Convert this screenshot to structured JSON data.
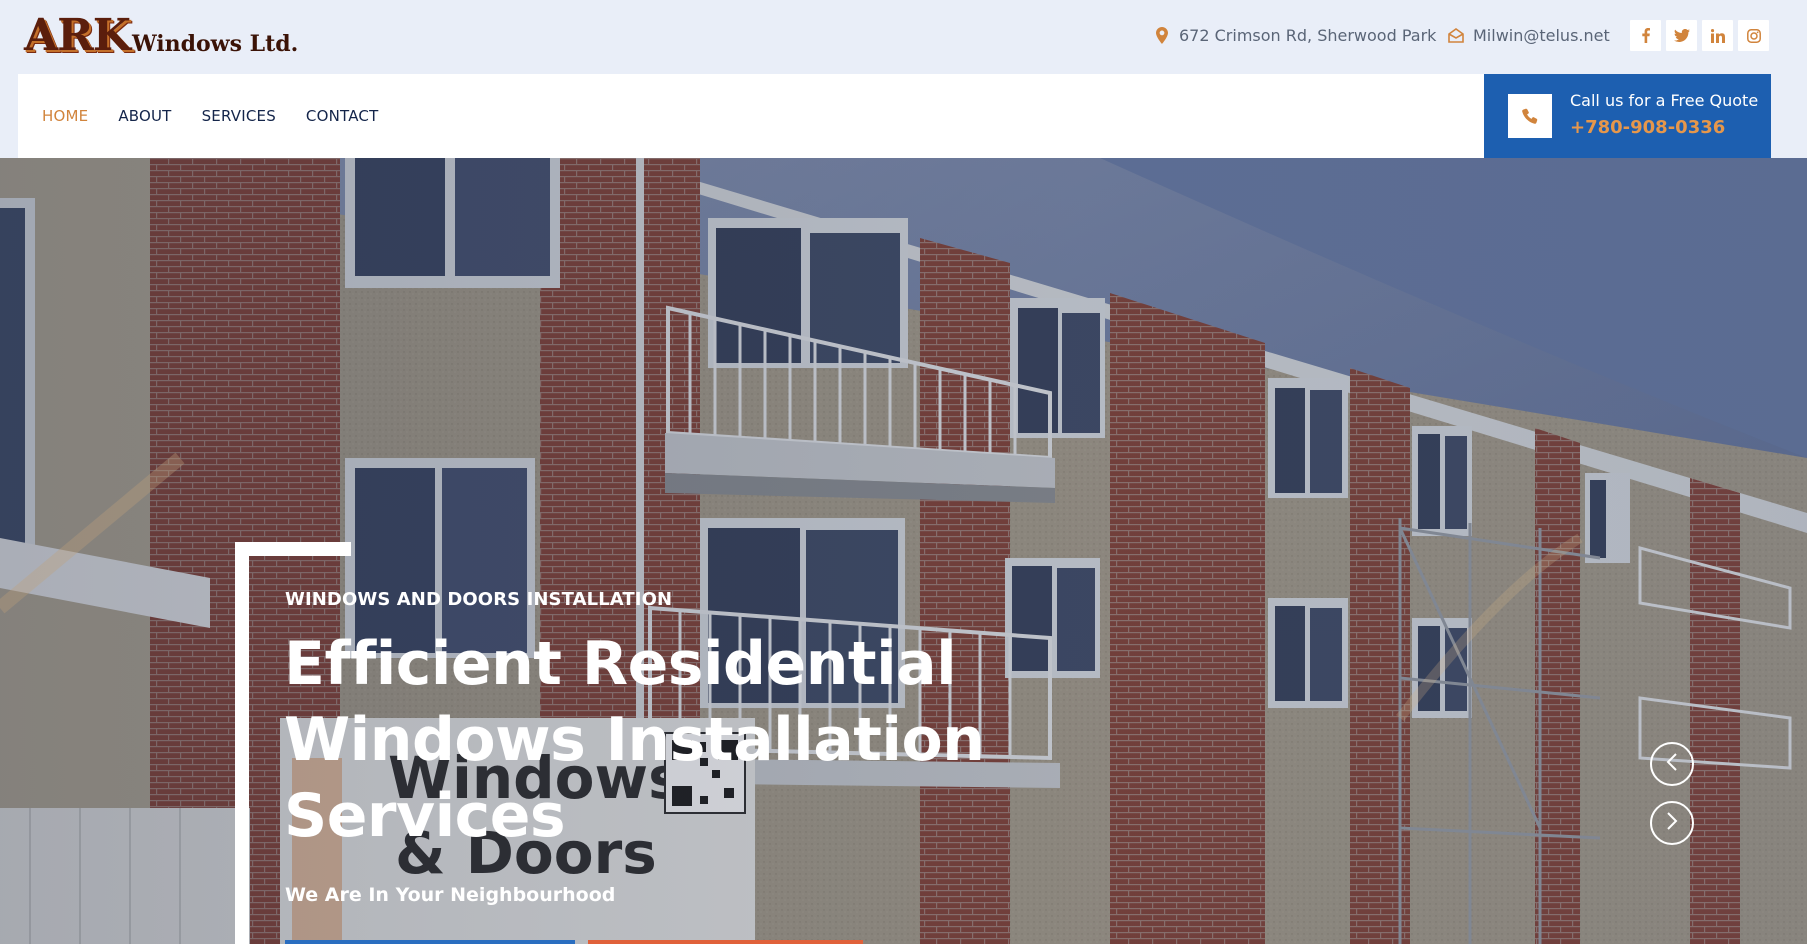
{
  "header": {
    "logo": {
      "ark": "ARK",
      "rest": "Windows Ltd."
    },
    "address": "672 Crimson Rd, Sherwood Park",
    "email": "Milwin@telus.net",
    "socials": [
      {
        "name": "facebook",
        "glyph": "f"
      },
      {
        "name": "twitter",
        "glyph": "t"
      },
      {
        "name": "linkedin",
        "glyph": "in"
      },
      {
        "name": "instagram",
        "glyph": "ig"
      }
    ]
  },
  "nav": {
    "items": [
      {
        "label": "HOME",
        "active": true
      },
      {
        "label": "ABOUT",
        "active": false
      },
      {
        "label": "SERVICES",
        "active": false
      },
      {
        "label": "CONTACT",
        "active": false
      }
    ]
  },
  "quote": {
    "label": "Call us for a Free Quote",
    "number": "+780-908-0336"
  },
  "hero": {
    "eyebrow": "WINDOWS AND DOORS INSTALLATION",
    "title_lines": [
      "Efficient Residential",
      "Windows Installation",
      "Services"
    ],
    "subtitle": "We Are In Your Neighbourhood",
    "sign_text": "Windows"
  },
  "colors": {
    "accent": "#d1843c",
    "nav_text": "#14254a",
    "quote_bg": "#1d5fb0",
    "topbar_bg": "#e9eef8"
  }
}
